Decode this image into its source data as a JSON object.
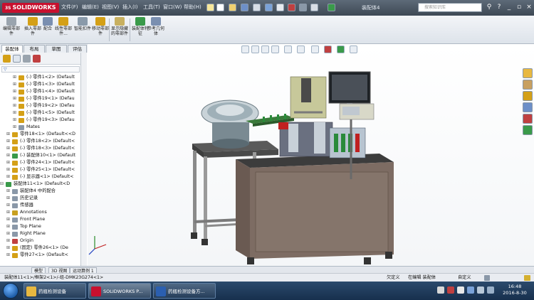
{
  "titlebar": {
    "logo": "SOLIDWORKS",
    "logo_prefix": "3S",
    "menus": [
      "文件(F)",
      "编辑(E)",
      "视图(V)",
      "插入(I)",
      "工具(T)",
      "窗口(W)",
      "帮助(H)"
    ],
    "document_title": "装配体4",
    "search_placeholder": "搜索知识库"
  },
  "ribbon": {
    "buttons": [
      {
        "label": "编辑零部件",
        "icon": "edit-component-icon",
        "color": "#9aa4ae"
      },
      {
        "label": "插入零部件",
        "icon": "insert-component-icon",
        "color": "#d4a017"
      },
      {
        "label": "配合",
        "icon": "mate-icon",
        "color": "#7a8fb0"
      },
      {
        "label": "线性零部件...",
        "icon": "linear-pattern-icon",
        "color": "#d4a017"
      },
      {
        "label": "智能扣件",
        "icon": "smart-fastener-icon",
        "color": "#8a9aaa"
      },
      {
        "label": "移动零部件",
        "icon": "move-component-icon",
        "color": "#d4a017"
      },
      {
        "label": "显示隐藏的零部件",
        "icon": "show-hidden-icon",
        "color": "#c8b060"
      },
      {
        "label": "装配体特征",
        "icon": "assembly-feature-icon",
        "color": "#3a9a4a"
      },
      {
        "label": "参考几何体",
        "icon": "reference-geometry-icon",
        "color": "#7a8fb0"
      }
    ]
  },
  "tabs": [
    "装配体",
    "布局",
    "草图",
    "评估"
  ],
  "tree": {
    "filter": "",
    "rows": [
      {
        "level": 2,
        "label": "(-) 零件1<2> (Default",
        "icon": "#d4a017"
      },
      {
        "level": 2,
        "label": "(-) 零件1<3> (Default",
        "icon": "#d4a017"
      },
      {
        "level": 2,
        "label": "(-) 零件1<4> (Default",
        "icon": "#d4a017"
      },
      {
        "level": 2,
        "label": "(-) 零件19<1> (Defau",
        "icon": "#d4a017"
      },
      {
        "level": 2,
        "label": "(-) 零件19<2> (Defau",
        "icon": "#d4a017"
      },
      {
        "level": 2,
        "label": "(-) 零件1<5> (Default",
        "icon": "#d4a017"
      },
      {
        "level": 2,
        "label": "(-) 零件19<3> (Defau",
        "icon": "#d4a017"
      },
      {
        "level": 2,
        "label": "Mates",
        "icon": "#8a98a8"
      },
      {
        "level": 1,
        "label": "零件18<1> (Default<<D",
        "icon": "#d4a017"
      },
      {
        "level": 1,
        "label": "(-) 零件18<2> (Default<",
        "icon": "#d4a017"
      },
      {
        "level": 1,
        "label": "(-) 零件18<3> (Default<",
        "icon": "#d4a017"
      },
      {
        "level": 1,
        "label": "(-) 装配体10<1> (Default",
        "icon": "#3a9a4a"
      },
      {
        "level": 1,
        "label": "(-) 零件24<1> (Default<",
        "icon": "#d4a017"
      },
      {
        "level": 1,
        "label": "(-) 零件25<1> (Default<",
        "icon": "#d4a017"
      },
      {
        "level": 1,
        "label": "(-) 显示器<1> (Default<",
        "icon": "#d4a017"
      },
      {
        "level": 0,
        "label": "装配体11<1> (Default<D",
        "icon": "#3a9a4a",
        "expanded": true
      },
      {
        "level": 1,
        "label": "装配体4 中的配合",
        "icon": "#8a98a8"
      },
      {
        "level": 1,
        "label": "历史记录",
        "icon": "#8a98a8"
      },
      {
        "level": 1,
        "label": "传感器",
        "icon": "#8a98a8"
      },
      {
        "level": 1,
        "label": "Annotations",
        "icon": "#c8a020"
      },
      {
        "level": 1,
        "label": "Front Plane",
        "icon": "#8a98a8"
      },
      {
        "level": 1,
        "label": "Top Plane",
        "icon": "#8a98a8"
      },
      {
        "level": 1,
        "label": "Right Plane",
        "icon": "#8a98a8"
      },
      {
        "level": 1,
        "label": "Origin",
        "icon": "#c04040"
      },
      {
        "level": 1,
        "label": "(固定) 零件26<1> (De",
        "icon": "#d4a017"
      },
      {
        "level": 1,
        "label": "零件27<1> (Default<",
        "icon": "#d4a017"
      }
    ]
  },
  "bottom_tabs": [
    "模型",
    "3D 视图",
    "运动算例 1"
  ],
  "statusbar": {
    "path": "装配体11<1>/框架2<1>/-组-DMK23G274<1>",
    "state1": "欠定义",
    "state2": "在编辑 装配体",
    "custom": "自定义"
  },
  "taskbar": {
    "items": [
      {
        "label": "药瓶检测设备",
        "icon": "folder-icon",
        "color": "#e8b840"
      },
      {
        "label": "SOLIDWORKS P...",
        "icon": "solidworks-icon",
        "color": "#c8102e",
        "active": true
      },
      {
        "label": "药瓶检测设备方...",
        "icon": "word-icon",
        "color": "#2b5fb0"
      }
    ],
    "time": "16:48",
    "date": "2016-8-30"
  },
  "colors": {
    "accent": "#c8102e",
    "frame": "#5a5a5a",
    "cabinet": "#7d6c63",
    "bowl": "#9fb0b8"
  }
}
